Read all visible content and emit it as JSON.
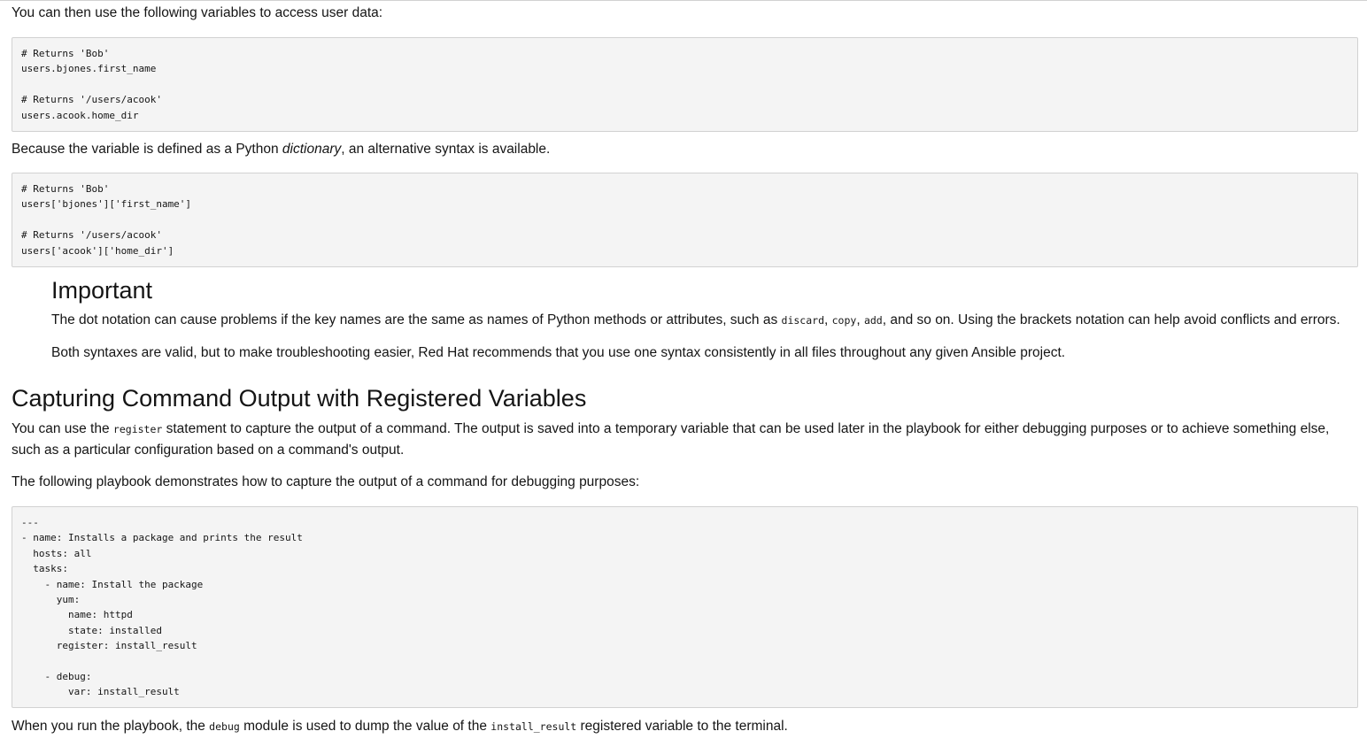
{
  "intro_text": "You can then use the following variables to access user data:",
  "code_block_1": "# Returns 'Bob'\nusers.bjones.first_name\n\n# Returns '/users/acook'\nusers.acook.home_dir",
  "dict_para": {
    "before": "Because the variable is defined as a Python ",
    "emphasis": "dictionary",
    "after": ", an alternative syntax is available."
  },
  "code_block_2": "# Returns 'Bob'\nusers['bjones']['first_name']\n\n# Returns '/users/acook'\nusers['acook']['home_dir']",
  "admonition": {
    "title": "Important",
    "para1": {
      "t1": "The dot notation can cause problems if the key names are the same as names of Python methods or attributes, such as ",
      "c1": "discard",
      "t2": ", ",
      "c2": "copy",
      "t3": ", ",
      "c3": "add",
      "t4": ", and so on. Using the brackets notation can help avoid conflicts and errors."
    },
    "para2": "Both syntaxes are valid, but to make troubleshooting easier, Red Hat recommends that you use one syntax consistently in all files throughout any given Ansible project."
  },
  "section_heading": "Capturing Command Output with Registered Variables",
  "register_para": {
    "before": "You can use the ",
    "code": "register",
    "after": " statement to capture the output of a command. The output is saved into a temporary variable that can be used later in the playbook for either debugging purposes or to achieve something else, such as a particular configuration based on a command's output."
  },
  "playbook_intro": "The following playbook demonstrates how to capture the output of a command for debugging purposes:",
  "code_block_3": "---\n- name: Installs a package and prints the result\n  hosts: all\n  tasks:\n    - name: Install the package\n      yum:\n        name: httpd\n        state: installed\n      register: install_result\n\n    - debug:\n        var: install_result",
  "run_para": {
    "t1": "When you run the playbook, the ",
    "c1": "debug",
    "t2": " module is used to dump the value of the ",
    "c2": "install_result",
    "t3": " registered variable to the terminal."
  }
}
